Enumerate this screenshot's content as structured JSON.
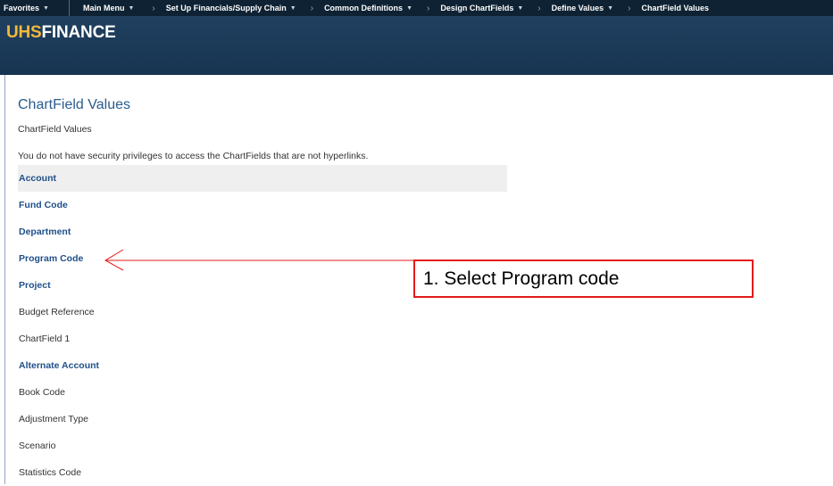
{
  "topnav": {
    "favorites": "Favorites",
    "main_menu": "Main Menu",
    "breadcrumbs": [
      "Set Up Financials/Supply Chain",
      "Common Definitions",
      "Design ChartFields",
      "Define Values",
      "ChartField Values"
    ]
  },
  "banner": {
    "logo_prefix": "UHS",
    "logo_suffix": "FINANCE"
  },
  "page": {
    "title": "ChartField Values",
    "breadcrumb": "ChartField Values",
    "notice": "You do not have security privileges to access the ChartFields that are not hyperlinks."
  },
  "chartfields": [
    {
      "label": "Account",
      "link": true
    },
    {
      "label": "Fund Code",
      "link": true
    },
    {
      "label": "Department",
      "link": true
    },
    {
      "label": "Program Code",
      "link": true
    },
    {
      "label": "Project",
      "link": true
    },
    {
      "label": "Budget Reference",
      "link": false
    },
    {
      "label": "ChartField 1",
      "link": false
    },
    {
      "label": "Alternate Account",
      "link": true
    },
    {
      "label": "Book Code",
      "link": false
    },
    {
      "label": "Adjustment Type",
      "link": false
    },
    {
      "label": "Scenario",
      "link": false
    },
    {
      "label": "Statistics Code",
      "link": false
    }
  ],
  "annotation": {
    "text": "1. Select Program code",
    "color": "#e31b1b"
  }
}
